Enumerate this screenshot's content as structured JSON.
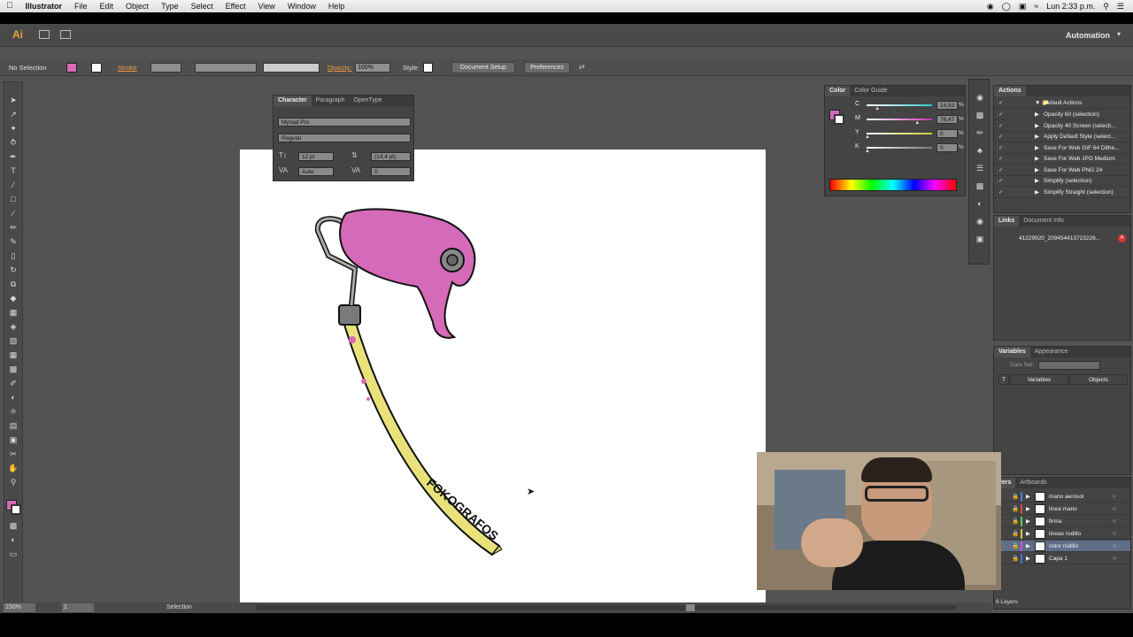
{
  "menubar": {
    "apple": "",
    "app": "Illustrator",
    "items": [
      "File",
      "Edit",
      "Object",
      "Type",
      "Select",
      "Effect",
      "View",
      "Window",
      "Help"
    ],
    "clock": "Lun 2:33 p.m."
  },
  "appbar": {
    "logo": "Ai",
    "workspace": "Automation"
  },
  "control": {
    "selection": "No Selection",
    "stroke_label": "Stroke",
    "opacity_label": "Opacity:",
    "opacity_value": "100%",
    "style_label": "Style:",
    "doc_setup": "Document Setup",
    "preferences": "Preferences"
  },
  "character": {
    "tabs": [
      "Character",
      "Paragraph",
      "OpenType"
    ],
    "font": "Myriad Pro",
    "style": "Regular",
    "size": "12 pt",
    "leading": "(14,4 pt)",
    "kerning": "Auto",
    "tracking": "0"
  },
  "color": {
    "tabs": [
      "Color",
      "Color Guide"
    ],
    "channels": [
      {
        "label": "C",
        "value": "14,93",
        "pct": 0.15
      },
      {
        "label": "M",
        "value": "76,47",
        "pct": 0.76
      },
      {
        "label": "Y",
        "value": "0",
        "pct": 0
      },
      {
        "label": "K",
        "value": "0",
        "pct": 0
      }
    ],
    "pct_sign": "%",
    "fill_color": "#d46ab8"
  },
  "actions": {
    "title": "Actions",
    "set": "Default Actions",
    "items": [
      "Opacity 60 (selection)",
      "Opacity 40 Screen (selecti...",
      "Apply Default Style (select...",
      "Save For Web GIF 64 Dithe...",
      "Save For Web JPG Medium",
      "Save For Web PNG 24",
      "Simplify (selection)",
      "Simplify Straight (selection)"
    ]
  },
  "links": {
    "tabs": [
      "Links",
      "Document Info"
    ],
    "file": "41229920_209454413723226..."
  },
  "variables": {
    "tabs": [
      "Variables",
      "Appearance"
    ],
    "dataset_label": "Data Set:",
    "col_variables": "Variables",
    "col_objects": "Objects",
    "col_t": "T"
  },
  "layers": {
    "tabs": [
      "yers",
      "Artboards"
    ],
    "items": [
      {
        "name": "mano aerosol",
        "color": "#4f7fd6"
      },
      {
        "name": "linea mano",
        "color": "#d64f4f"
      },
      {
        "name": "firma",
        "color": "#4fd64f"
      },
      {
        "name": "lineas rodillo",
        "color": "#d6c24f"
      },
      {
        "name": "color rodillo",
        "color": "#d64fd6"
      },
      {
        "name": "Capa 1",
        "color": "#4f6fd6"
      }
    ],
    "count": "6 Layers"
  },
  "status": {
    "zoom": "150%",
    "artboard": "1",
    "tool": "Selection"
  },
  "art": {
    "signature": "FOKOGRAFOS"
  }
}
